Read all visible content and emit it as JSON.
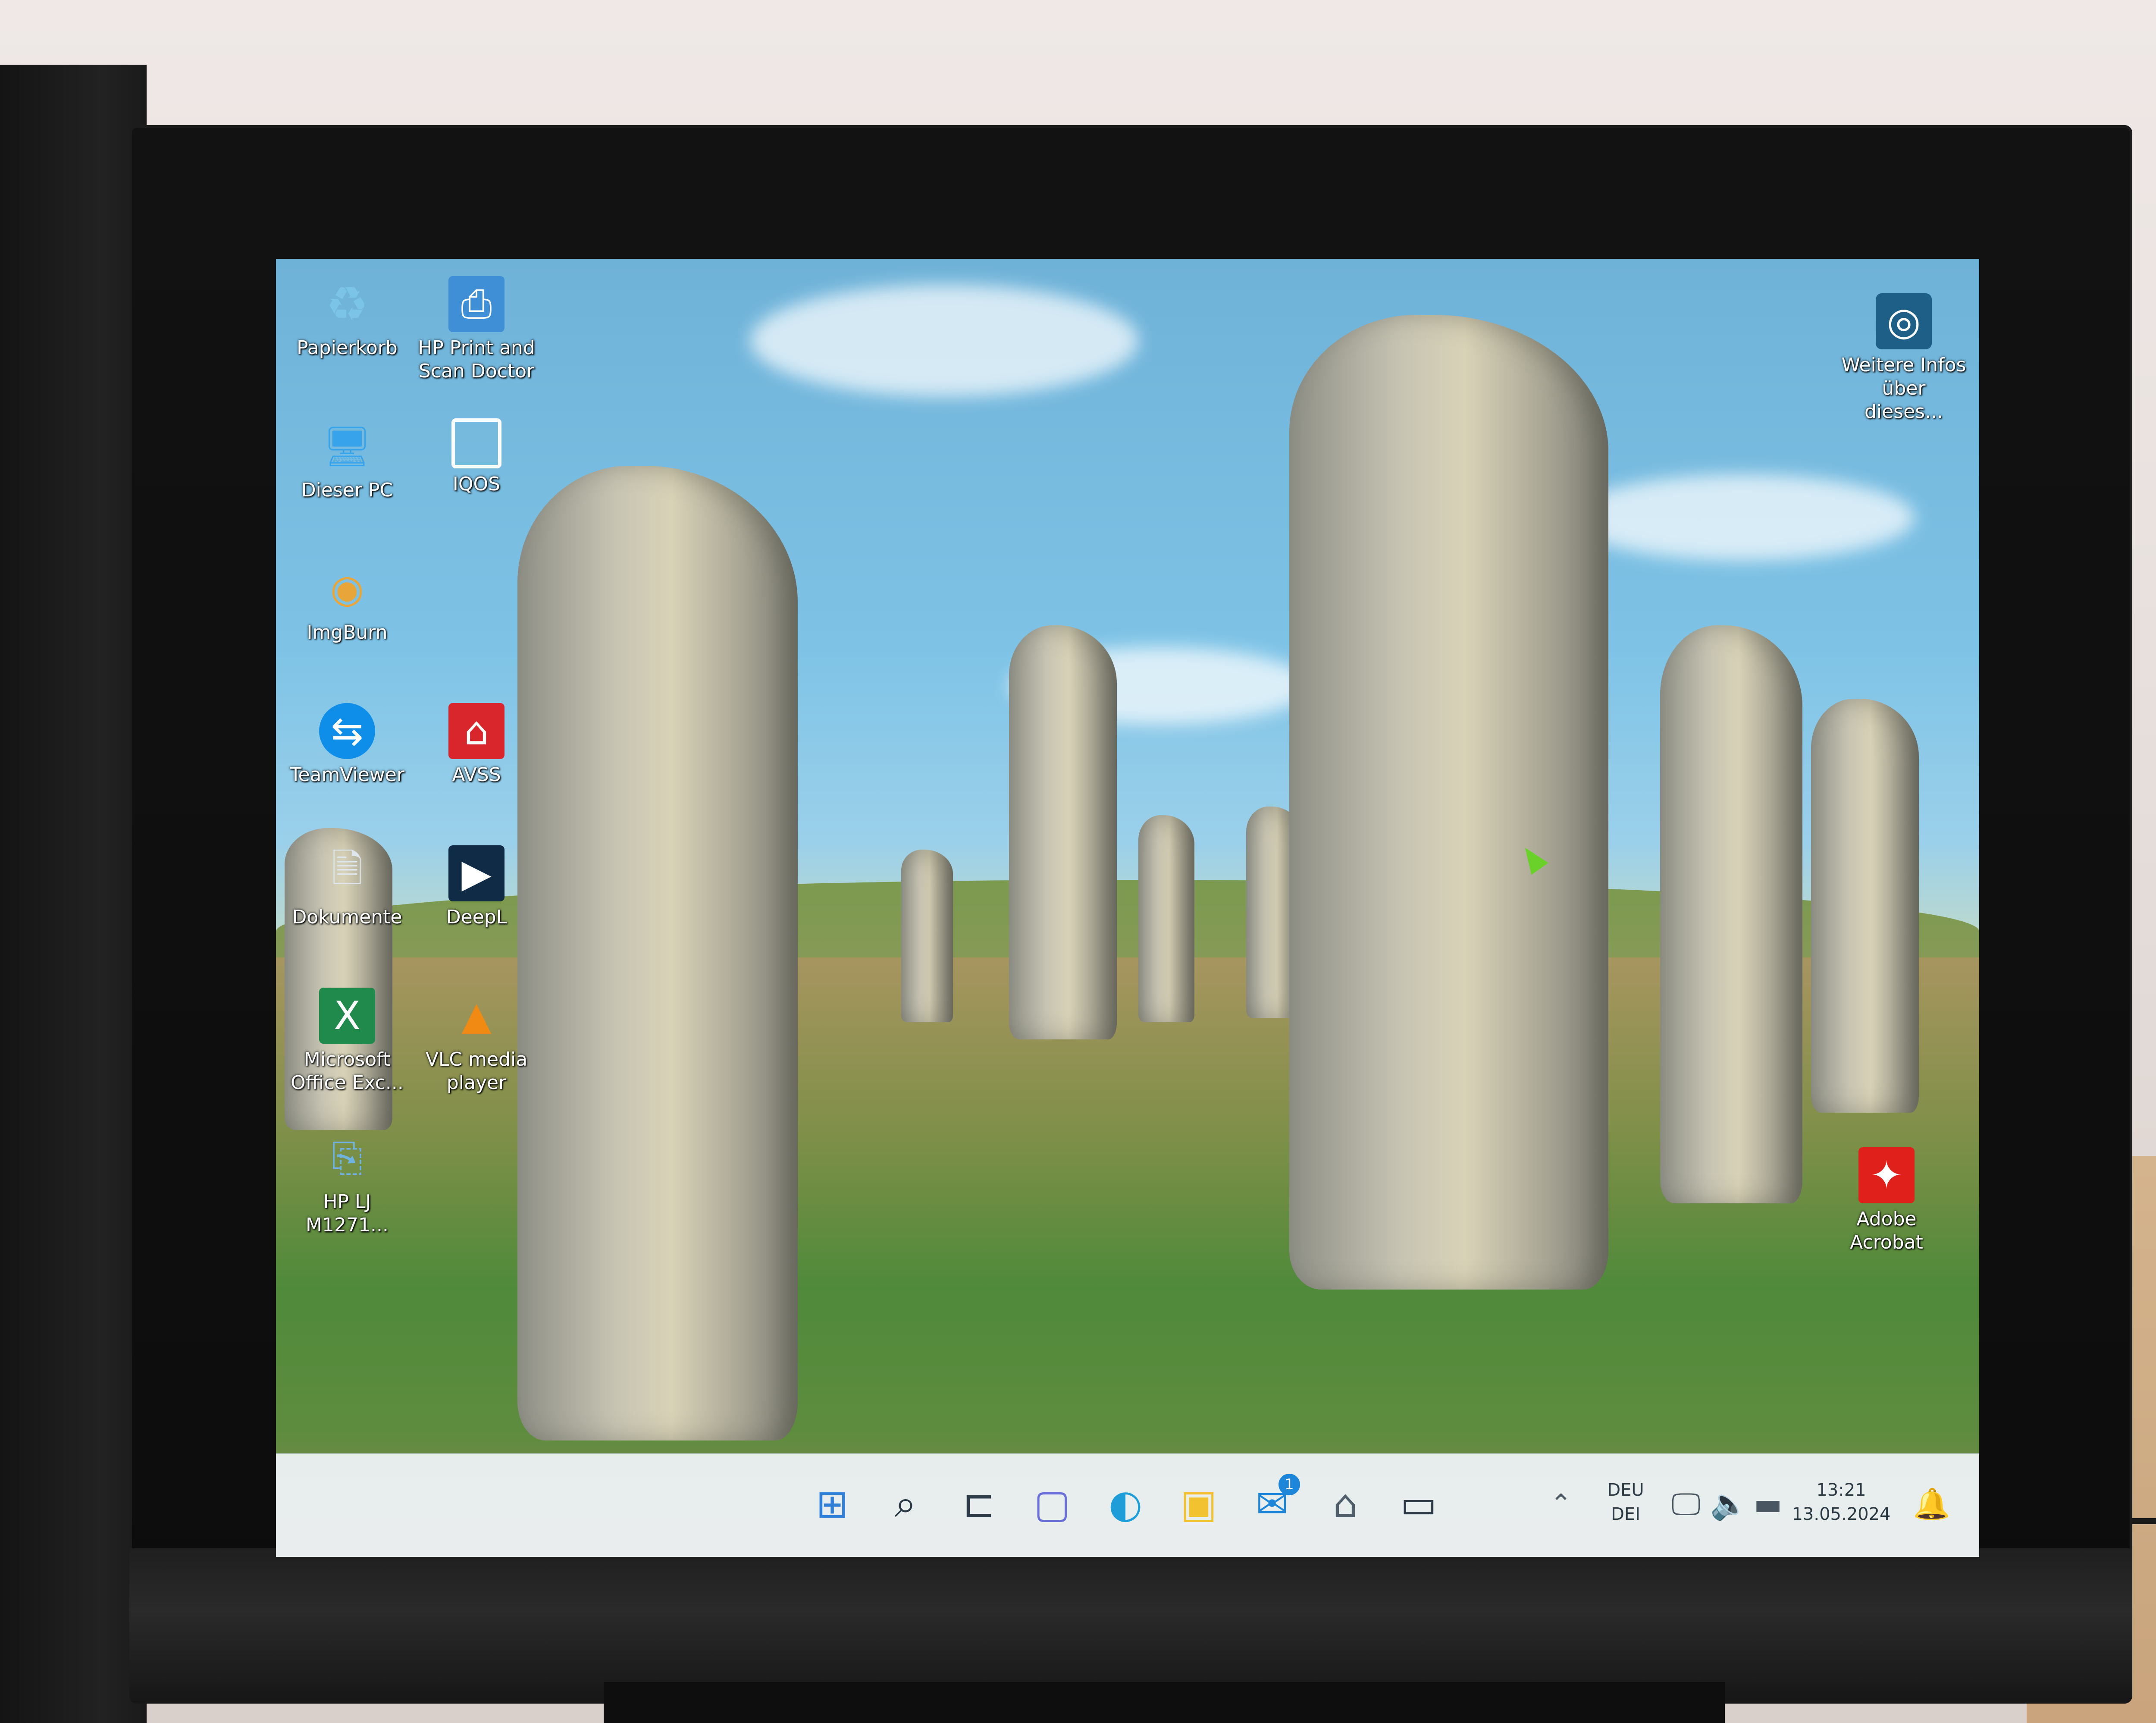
{
  "desktop": {
    "icons": [
      {
        "key": "recycle",
        "label": "Papierkorb",
        "icon": "recycle-bin-icon"
      },
      {
        "key": "hp-print",
        "label": "HP Print and Scan Doctor",
        "icon": "hp-print-icon"
      },
      {
        "key": "this-pc",
        "label": "Dieser PC",
        "icon": "monitor-icon"
      },
      {
        "key": "iqos",
        "label": "IQOS",
        "icon": "iqos-icon"
      },
      {
        "key": "imgburn",
        "label": "ImgBurn",
        "icon": "disc-icon"
      },
      {
        "key": "teamviewer",
        "label": "TeamViewer",
        "icon": "teamviewer-icon"
      },
      {
        "key": "avss",
        "label": "AVSS",
        "icon": "house-icon"
      },
      {
        "key": "dokumente",
        "label": "Dokumente",
        "icon": "document-icon"
      },
      {
        "key": "deepl",
        "label": "DeepL",
        "icon": "deepl-icon"
      },
      {
        "key": "excel",
        "label": "Microsoft Office Exc...",
        "icon": "excel-icon"
      },
      {
        "key": "vlc",
        "label": "VLC media player",
        "icon": "vlc-icon"
      },
      {
        "key": "hp-lj",
        "label": "HP LJ M1271...",
        "icon": "scanner-icon"
      },
      {
        "key": "acrobat",
        "label": "Adobe Acrobat",
        "icon": "acrobat-icon"
      },
      {
        "key": "spotlight",
        "label": "Weitere Infos über dieses...",
        "icon": "camera-info-icon"
      }
    ]
  },
  "taskbar": {
    "icons": [
      "start-icon",
      "search-icon",
      "widgets-icon",
      "chat-icon",
      "edge-icon",
      "file-explorer-icon",
      "mail-icon",
      "camera-icon",
      "terminal-icon"
    ],
    "mail_badge": "1",
    "language_top": "DEU",
    "language_bottom": "DEI",
    "time": "13:21",
    "date": "13.05.2024"
  },
  "colors": {
    "taskbar_bg": "#ECF1F4",
    "acrobat_red": "#E0201B",
    "avss_red": "#D9262C",
    "teamviewer_blue": "#0E8EE9",
    "deepl_blue": "#0F2B46"
  }
}
